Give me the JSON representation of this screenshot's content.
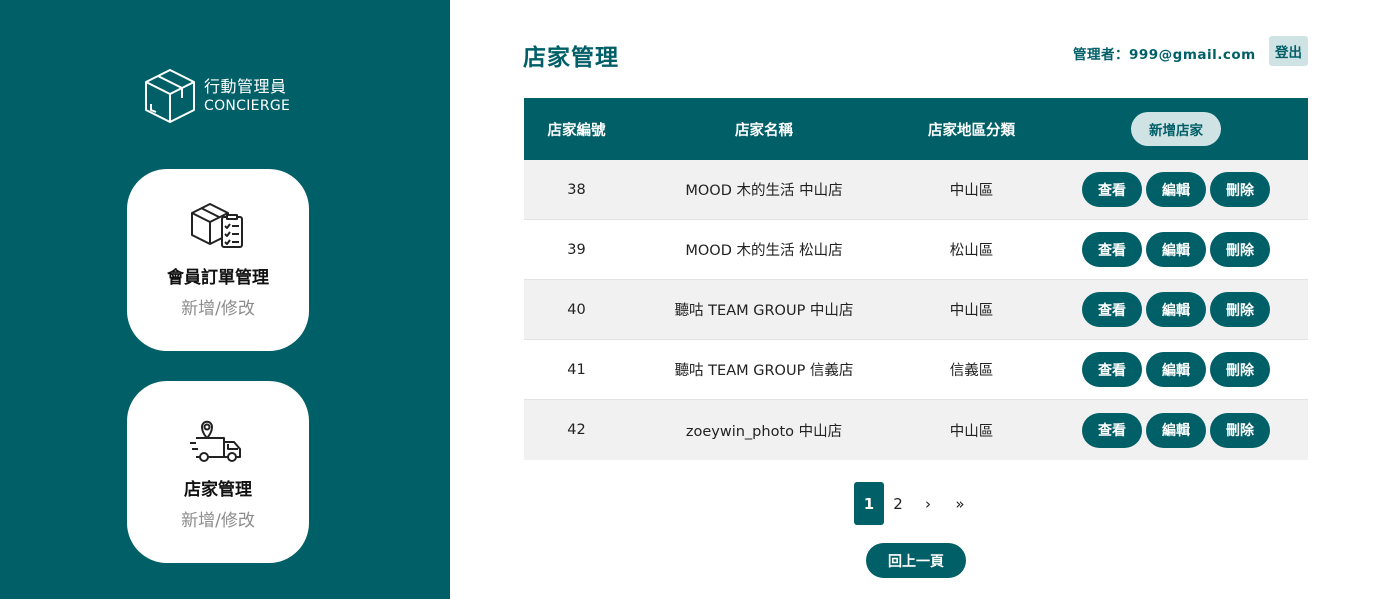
{
  "sidebar": {
    "logo": {
      "cn": "行動管理員",
      "en": "CONCIERGE"
    },
    "cards": [
      {
        "title": "會員訂單管理",
        "subtitle": "新增/修改",
        "icon": "box-checklist-icon"
      },
      {
        "title": "店家管理",
        "subtitle": "新增/修改",
        "icon": "delivery-truck-icon"
      }
    ]
  },
  "header": {
    "title": "店家管理",
    "admin": "管理者：999@gmail.com",
    "logout_label": "登出"
  },
  "table": {
    "columns": [
      "店家編號",
      "店家名稱",
      "店家地區分類"
    ],
    "add_label": "新增店家",
    "rows": [
      {
        "id": "38",
        "name": "MOOD 木的生活 中山店",
        "area": "中山區"
      },
      {
        "id": "39",
        "name": "MOOD 木的生活 松山店",
        "area": "松山區"
      },
      {
        "id": "40",
        "name": "聽咕 TEAM GROUP 中山店",
        "area": "中山區"
      },
      {
        "id": "41",
        "name": "聽咕 TEAM GROUP 信義店",
        "area": "信義區"
      },
      {
        "id": "42",
        "name": "zoeywin_photo 中山店",
        "area": "中山區"
      }
    ],
    "actions": {
      "view": "查看",
      "edit": "編輯",
      "delete": "刪除"
    }
  },
  "pagination": {
    "pages": [
      "1",
      "2"
    ],
    "current": "1",
    "next": "›",
    "last": "»"
  },
  "back_label": "回上一頁",
  "colors": {
    "primary": "#005f67",
    "light": "#cfe3e5",
    "row_alt": "#f1f1f1"
  }
}
